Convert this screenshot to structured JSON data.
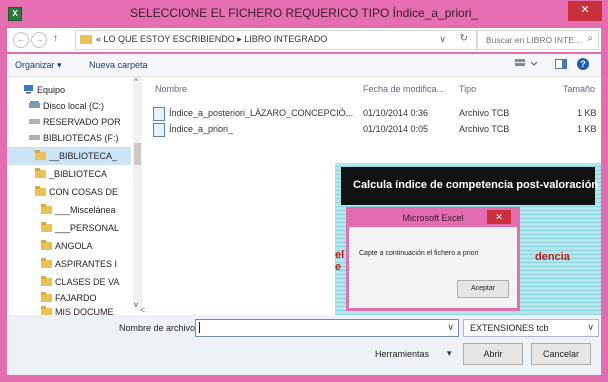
{
  "window": {
    "title": "SELECCIONE EL FICHERO REQUERICO TIPO Índice_a_priori_",
    "close_label": "✕"
  },
  "nav_buttons": {
    "back": "←",
    "forward": "→",
    "up": "↑"
  },
  "address": {
    "path": "« LO QUE ESTOY ESCRIBIENDO ▸ LIBRO INTEGRADO",
    "dropdown": "∨",
    "refresh": "↻"
  },
  "search": {
    "placeholder": "Buscar en LIBRO INTE...",
    "icon": "⌕"
  },
  "toolbar": {
    "organize": "Organizar ▾",
    "new_folder": "Nueva carpeta",
    "help": "?"
  },
  "sidebar": {
    "items": [
      {
        "label": "Equipo",
        "icon": "computer-icon"
      },
      {
        "label": "Disco local (C:)",
        "icon": "drive-icon"
      },
      {
        "label": "RESERVADO POR",
        "icon": "drive-icon"
      },
      {
        "label": "BIBLIOTECAS (F:)",
        "icon": "drive-icon"
      },
      {
        "label": "__BIBLIOTECA_",
        "icon": "folder-icon"
      },
      {
        "label": "_BIBLIOTECA",
        "icon": "folder-icon"
      },
      {
        "label": "CON COSAS DE",
        "icon": "folder-icon"
      },
      {
        "label": "___Miscelánea",
        "icon": "folder-icon"
      },
      {
        "label": "___PERSONAL",
        "icon": "folder-icon"
      },
      {
        "label": "ANGOLA",
        "icon": "folder-icon"
      },
      {
        "label": "ASPIRANTES I",
        "icon": "folder-icon"
      },
      {
        "label": "CLASES DE VA",
        "icon": "folder-icon"
      },
      {
        "label": "FAJARDO",
        "icon": "folder-icon"
      },
      {
        "label": "MIS DOCUME",
        "icon": "folder-icon"
      }
    ]
  },
  "columns": {
    "name": "Nombre",
    "date": "Fecha de modifica...",
    "type": "Tipo",
    "size": "Tamaño"
  },
  "files": [
    {
      "name": "Índice_a_posteriori_LÁZARO_CONCEPCIÓ...",
      "date": "01/10/2014 0:36",
      "type": "Archivo TCB",
      "size": "1 KB"
    },
    {
      "name": "Índice_a_priori_",
      "date": "01/10/2014 0:05",
      "type": "Archivo TCB",
      "size": "1 KB"
    }
  ],
  "background_app": {
    "banner": "Calcula índice de competencia post-valoración",
    "red_left": "el",
    "red_right": "dencia",
    "red_left2": "e"
  },
  "excel_dialog": {
    "title": "Microsoft Excel",
    "message": "Capte a continuación el fichero a priori",
    "ok": "Aceptar",
    "close": "✕"
  },
  "bottom": {
    "filename_label": "Nombre de archivo:",
    "filename_value": "",
    "filter": "EXTENSIONES tcb",
    "tools": "Herramientas",
    "open": "Abrir",
    "cancel": "Cancelar"
  },
  "colors": {
    "accent": "#e46db0",
    "close": "#c8303c"
  }
}
